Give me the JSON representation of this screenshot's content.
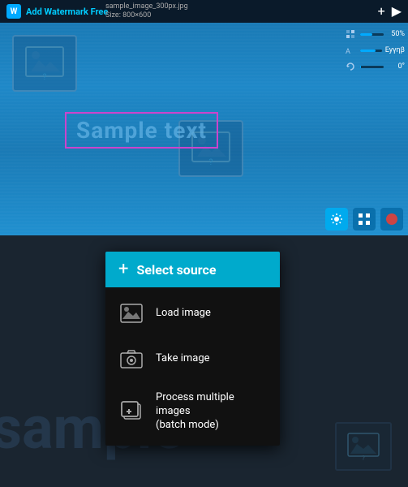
{
  "app": {
    "title": "Add Watermark Free",
    "filename": "sample_image_300px.jpg",
    "filesize": "Size: 800×600"
  },
  "toolbar": {
    "add_label": "+",
    "play_label": "▶"
  },
  "sliders": [
    {
      "icon": "volume",
      "value": "50%",
      "fill_pct": 50
    },
    {
      "icon": "brightness",
      "value": "Eyγηβ",
      "fill_pct": 70
    },
    {
      "icon": "rotate",
      "value": "0°",
      "fill_pct": 0
    }
  ],
  "canvas": {
    "sample_text": "Sample text"
  },
  "dialog": {
    "header_icon": "+",
    "title": "Select source",
    "items": [
      {
        "icon": "image",
        "label": "Load image"
      },
      {
        "icon": "camera",
        "label": "Take image"
      },
      {
        "icon": "batch",
        "label": "Process multiple images\n(batch mode)"
      }
    ]
  },
  "bottom": {
    "bg_text": "sample"
  }
}
